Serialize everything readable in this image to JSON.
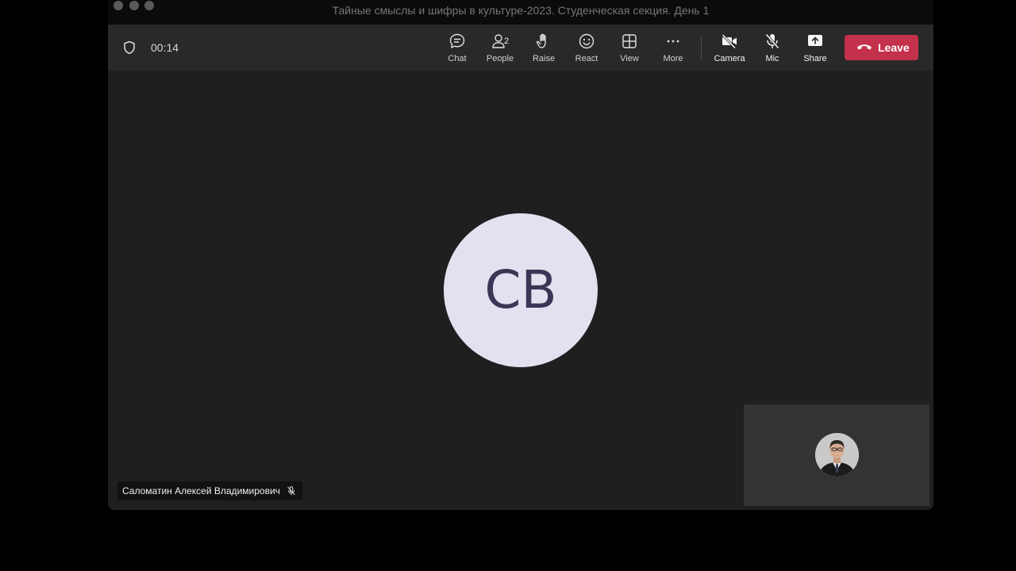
{
  "window": {
    "title": "Тайные смыслы и шифры в культуре-2023. Студенческая секция. День 1"
  },
  "toolbar": {
    "timer": "00:14",
    "chat_label": "Chat",
    "people_label": "People",
    "people_count": "2",
    "raise_label": "Raise",
    "react_label": "React",
    "view_label": "View",
    "more_label": "More",
    "camera_label": "Camera",
    "mic_label": "Mic",
    "share_label": "Share",
    "leave_label": "Leave"
  },
  "stage": {
    "main_participant_initials": "СВ",
    "main_participant_name": "Саломатин Алексей Владимирович",
    "main_participant_muted": true
  },
  "colors": {
    "leave": "#c4314b",
    "avatar_bg": "#e4e0f0",
    "avatar_text": "#3a3656",
    "toolbar_bg": "#292929",
    "stage_bg": "#1f1f1f"
  },
  "icons": {
    "shield": "shield-icon",
    "chat": "chat-bubble-icon",
    "people": "person-icon",
    "raise": "raised-hand-icon",
    "react": "smiley-icon",
    "view": "grid-icon",
    "more": "ellipsis-icon",
    "camera": "camera-off-icon",
    "mic": "mic-off-icon",
    "share": "share-screen-icon",
    "leave": "phone-hangup-icon"
  }
}
